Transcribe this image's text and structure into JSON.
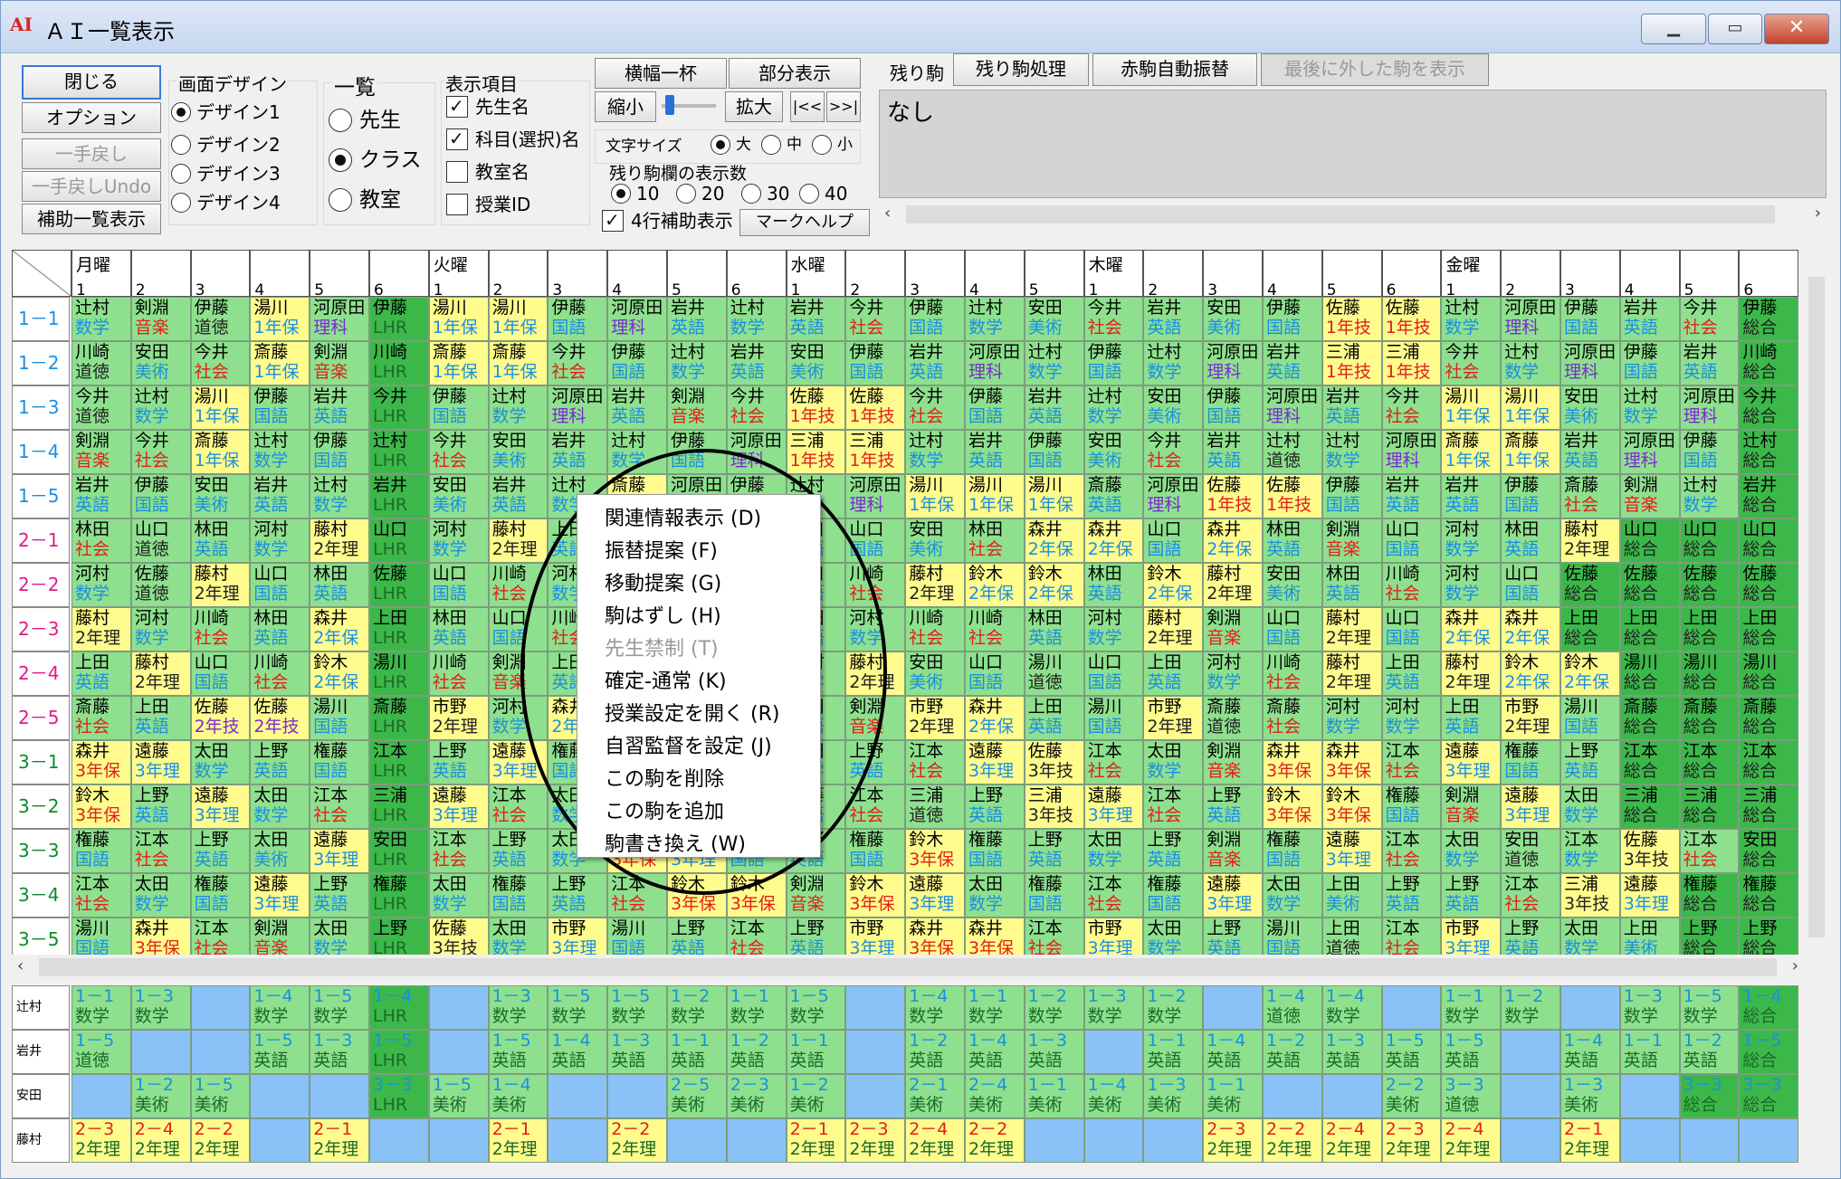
{
  "window": {
    "title": "ＡＩ一覧表示",
    "app_icon": "AI"
  },
  "toolbar": {
    "close_btn": "閉じる",
    "option_btn": "オプション",
    "undo_btn": "一手戻し",
    "undo_undo_btn": "一手戻しUndo",
    "aux_list_btn": "補助一覧表示",
    "design_label": "画面デザイン",
    "designs": [
      "デザイン1",
      "デザイン2",
      "デザイン3",
      "デザイン4"
    ],
    "list_label": "一覧",
    "list_modes": [
      "先生",
      "クラス",
      "教室"
    ],
    "display_label": "表示項目",
    "display_items": [
      "先生名",
      "科目(選択)名",
      "教室名",
      "授業ID"
    ],
    "full_width_btn": "横幅一杯",
    "partial_btn": "部分表示",
    "shrink_btn": "縮小",
    "expand_btn": "拡大",
    "prev_btn": "|<<",
    "next_btn": ">>|",
    "font_label": "文字サイズ",
    "font_sizes": [
      "大",
      "中",
      "小"
    ],
    "remain_count_label": "残り駒欄の表示数",
    "remain_counts": [
      "10",
      "20",
      "30",
      "40"
    ],
    "four_row_label": "4行補助表示",
    "mark_help_btn": "マークヘルプ",
    "remain_label": "残り駒",
    "remain_proc_btn": "残り駒処理",
    "red_auto_btn": "赤駒自動振替",
    "last_removed_btn": "最後に外した駒を表示",
    "remain_value": "なし"
  },
  "days": [
    {
      "name": "月曜",
      "periods": 6
    },
    {
      "name": "火曜",
      "periods": 6
    },
    {
      "name": "水曜",
      "periods": 5
    },
    {
      "name": "木曜",
      "periods": 6
    },
    {
      "name": "金曜",
      "periods": 6
    }
  ],
  "classes": [
    "1－1",
    "1－2",
    "1－3",
    "1－4",
    "1－5",
    "2－1",
    "2－2",
    "2－3",
    "2－4",
    "2－5",
    "3－1",
    "3－2",
    "3－3",
    "3－4",
    "3－5"
  ],
  "class_rows": [
    "辻村|数学|b|g;剣淵|音楽|r|g;伊藤|道徳|d|g;湯川|1年保|b|y;河原田|理科|p|g;伊藤|LHR|d|d;湯川|1年保|b|y;湯川|1年保|b|y;伊藤|国語|b|g;河原田|理科|p|g;岩井|英語|b|g;辻村|数学|b|g;岩井|英語|b|g;今井|社会|r|g;伊藤|国語|b|g;辻村|数学|b|g;安田|美術|b|g;今井|社会|r|g;岩井|英語|b|g;安田|美術|b|g;伊藤|国語|b|g;佐藤|1年技|r|y;佐藤|1年技|r|y;辻村|数学|b|g;河原田|理科|p|g;伊藤|国語|b|g;岩井|英語|b|g;今井|社会|r|g;伊藤|総合|d|d",
    "川崎|道徳|d|g;安田|美術|b|g;今井|社会|r|g;斎藤|1年保|b|y;剣淵|音楽|r|g;川崎|LHR|d|d;斎藤|1年保|b|y;斎藤|1年保|b|y;今井|社会|r|g;伊藤|国語|b|g;辻村|数学|b|g;岩井|英語|b|g;安田|美術|b|g;伊藤|国語|b|g;岩井|英語|b|g;河原田|理科|p|g;辻村|数学|b|g;伊藤|国語|b|g;辻村|数学|b|g;河原田|理科|p|g;岩井|英語|b|g;三浦|1年技|r|y;三浦|1年技|r|y;今井|社会|r|g;辻村|数学|b|g;河原田|理科|p|g;伊藤|国語|b|g;岩井|英語|b|g;川崎|総合|d|d",
    "今井|道徳|d|g;辻村|数学|b|g;湯川|1年保|b|y;伊藤|国語|b|g;岩井|英語|b|g;今井|LHR|d|d;伊藤|国語|b|g;辻村|数学|b|g;河原田|理科|p|g;岩井|英語|b|g;剣淵|音楽|r|g;今井|社会|r|g;佐藤|1年技|r|y;佐藤|1年技|r|y;今井|社会|r|g;伊藤|国語|b|g;岩井|英語|b|g;辻村|数学|b|g;安田|美術|b|g;伊藤|国語|b|g;河原田|理科|p|g;岩井|英語|b|g;今井|社会|r|g;湯川|1年保|b|y;湯川|1年保|b|y;安田|美術|b|g;辻村|数学|b|g;河原田|理科|p|g;今井|総合|d|d",
    "剣淵|音楽|r|g;今井|社会|r|g;斎藤|1年保|b|y;辻村|数学|b|g;伊藤|国語|b|g;辻村|LHR|d|d;今井|社会|r|g;安田|美術|b|g;岩井|英語|b|g;辻村|数学|b|g;伊藤|国語|b|g;河原田|理科|p|g;三浦|1年技|r|y;三浦|1年技|r|y;辻村|数学|b|g;岩井|英語|b|g;伊藤|国語|b|g;安田|美術|b|g;今井|社会|r|g;岩井|英語|b|g;辻村|道徳|d|g;辻村|数学|b|g;河原田|理科|p|g;斎藤|1年保|b|y;斎藤|1年保|b|y;岩井|英語|b|g;河原田|理科|p|g;伊藤|国語|b|g;辻村|総合|d|d",
    "岩井|英語|b|g;伊藤|国語|b|g;安田|美術|b|g;岩井|英語|b|g;辻村|数学|b|g;岩井|LHR|d|d;安田|美術|b|g;岩井|英語|b|g;辻村|数学|b|g;斎藤|1年保|b|y;河原田|理科|p|g;伊藤|国語|b|g;辻村|数学|b|g;河原田|理科|p|g;湯川|1年保|b|y;湯川|1年保|b|y;湯川|1年保|b|y;斎藤|英語|b|g;河原田|理科|p|g;佐藤|1年技|r|y;佐藤|1年技|r|y;伊藤|国語|b|g;岩井|英語|b|g;岩井|英語|b|g;伊藤|国語|b|g;斎藤|社会|r|g;剣淵|音楽|r|g;辻村|数学|b|g;岩井|総合|d|d",
    "林田|社会|r|g;山口|道徳|d|g;林田|英語|b|g;河村|数学|b|g;藤村|2年理|d|y;山口|LHR|d|d;河村|数学|b|g;藤村|2年理|d|y;上田|英語|b|g;山口|国語|b|g;林田|英語|b|g;森井|2年保|b|y;山口|国語|b|g;山口|国語|b|g;安田|美術|b|g;林田|社会|r|g;森井|2年保|b|y;森井|2年保|b|y;山口|国語|b|g;森井|2年保|b|y;林田|英語|b|g;剣淵|音楽|r|g;山口|国語|b|g;河村|数学|b|g;林田|英語|b|g;藤村|2年理|d|y;山口|総合|d|d;山口|総合|d|d;山口|総合|d|d",
    "河村|数学|b|g;佐藤|道徳|d|g;藤村|2年理|d|y;山口|国語|b|g;林田|英語|b|g;佐藤|LHR|d|d;山口|国語|b|g;川崎|社会|r|g;河村|数学|b|g;林田|英語|b|g;山口|国語|b|g;林田|英語|b|g;山口|国語|b|g;川崎|社会|r|g;藤村|2年理|d|y;鈴木|2年保|b|y;鈴木|2年保|b|y;林田|英語|b|g;鈴木|2年保|b|y;藤村|2年理|d|y;安田|美術|b|g;林田|英語|b|g;川崎|社会|r|g;河村|数学|b|g;山口|国語|b|g;佐藤|総合|d|d;佐藤|総合|d|d;佐藤|総合|d|d;佐藤|総合|d|d",
    "藤村|2年理|d|y;河村|数学|b|g;川崎|社会|r|g;林田|英語|b|g;森井|2年保|b|y;上田|LHR|d|d;林田|英語|b|g;山口|国語|b|g;川崎|社会|r|g;山口|国語|b|g;林田|英語|b|g;藤村|2年理|d|y;林田|英語|b|g;河村|数学|b|g;川崎|社会|r|g;川崎|社会|r|g;林田|英語|b|g;河村|数学|b|g;藤村|2年理|d|y;剣淵|音楽|r|g;山口|国語|b|g;藤村|2年理|d|y;山口|国語|b|g;森井|2年保|b|y;森井|2年保|b|y;上田|総合|d|d;上田|総合|d|d;上田|総合|d|d;上田|総合|d|d",
    "上田|英語|b|g;藤村|2年理|d|y;山口|国語|b|g;川崎|社会|r|g;鈴木|2年保|b|y;湯川|LHR|d|d;川崎|社会|r|g;剣淵|音楽|r|g;上田|英語|b|g;河村|数学|b|g;林田|英語|b|g;藤村|2年理|d|y;河村|数学|b|g;藤村|2年理|d|y;安田|美術|b|g;山口|国語|b|g;湯川|道徳|d|g;山口|国語|b|g;上田|英語|b|g;河村|数学|b|g;川崎|社会|r|g;藤村|2年理|d|y;上田|英語|b|g;藤村|2年理|d|y;鈴木|2年保|b|y;鈴木|2年保|b|y;湯川|総合|d|d;湯川|総合|d|d;湯川|総合|d|d",
    "斎藤|社会|r|g;上田|英語|b|g;佐藤|2年技|p|y;佐藤|2年技|p|y;湯川|国語|b|g;斎藤|LHR|d|d;市野|2年理|d|y;河村|数学|b|g;森井|2年保|b|y;林田|英語|b|g;山口|国語|b|g;上田|英語|b|g;上田|英語|b|g;剣淵|音楽|r|g;市野|2年理|d|y;森井|2年保|b|y;上田|英語|b|g;湯川|国語|b|g;市野|2年理|d|y;斎藤|道徳|d|g;斎藤|社会|r|g;河村|数学|b|g;河村|数学|b|g;上田|英語|b|g;市野|2年理|d|y;湯川|国語|b|g;斎藤|総合|d|d;斎藤|総合|d|d;斎藤|総合|d|d",
    "森井|3年保|r|y;遠藤|3年理|b|y;太田|数学|b|g;上野|英語|b|g;権藤|国語|b|g;江本|LHR|d|d;上野|英語|b|g;遠藤|3年理|b|y;権藤|国語|b|g;江本|社会|r|g;太田|数学|b|g;上野|英語|b|g;太田|数学|b|g;上野|英語|b|g;江本|社会|r|g;遠藤|3年理|b|y;佐藤|3年技|d|y;江本|社会|r|g;太田|数学|b|g;剣淵|音楽|r|g;森井|3年保|r|y;森井|3年保|r|y;江本|社会|r|g;遠藤|3年理|b|y;権藤|国語|b|g;上野|英語|b|g;江本|総合|d|d;江本|総合|d|d;江本|総合|d|d",
    "鈴木|3年保|r|y;上野|英語|b|g;遠藤|3年理|b|y;太田|数学|b|g;江本|社会|r|g;三浦|LHR|d|d;遠藤|3年理|b|y;江本|社会|r|g;太田|数学|b|g;上野|英語|b|g;権藤|国語|b|g;三浦|道徳|d|g;権藤|国語|b|g;江本|社会|r|g;三浦|道徳|d|g;上野|英語|b|g;三浦|3年技|d|y;遠藤|3年理|b|y;江本|社会|r|g;上野|英語|b|g;鈴木|3年保|r|y;鈴木|3年保|r|y;権藤|国語|b|g;剣淵|音楽|r|g;遠藤|3年理|b|y;太田|数学|b|g;三浦|総合|d|d;三浦|総合|d|d;三浦|総合|d|d",
    "権藤|国語|b|g;江本|社会|r|g;上野|英語|b|g;太田|美術|b|g;遠藤|3年理|b|y;安田|LHR|d|d;江本|社会|r|g;上野|英語|b|g;太田|数学|b|g;鈴木|3年保|r|y;遠藤|3年理|b|y;権藤|国語|b|g;上野|英語|b|g;権藤|国語|b|g;鈴木|3年保|r|y;権藤|国語|b|g;上野|英語|b|g;太田|数学|b|g;上野|英語|b|g;剣淵|音楽|r|g;権藤|国語|b|g;遠藤|3年理|b|y;江本|社会|r|g;太田|数学|b|g;安田|道徳|d|g;江本|数学|b|g;佐藤|3年技|d|y;江本|社会|r|g;安田|総合|d|d",
    "江本|社会|r|g;太田|数学|b|g;権藤|国語|b|g;遠藤|3年理|b|y;上野|英語|b|g;権藤|LHR|d|d;太田|数学|b|g;権藤|国語|b|g;上野|英語|b|g;江本|社会|r|g;鈴木|3年保|r|y;鈴木|3年保|r|y;剣淵|音楽|r|g;鈴木|3年保|r|y;遠藤|3年理|b|y;太田|数学|b|g;権藤|国語|b|g;江本|社会|r|g;権藤|国語|b|g;遠藤|3年理|b|y;太田|数学|b|g;上田|美術|b|g;上野|英語|b|g;上野|英語|b|g;江本|社会|r|g;三浦|3年技|d|y;遠藤|3年理|b|y;権藤|総合|d|d;権藤|総合|d|d",
    "湯川|国語|b|g;森井|3年保|r|y;江本|社会|r|g;剣淵|音楽|r|g;太田|数学|b|g;上野|LHR|d|d;佐藤|3年技|d|y;太田|数学|b|g;市野|3年理|b|y;湯川|国語|b|g;上野|英語|b|g;江本|社会|r|g;上野|英語|b|g;市野|3年理|b|y;森井|3年保|r|y;森井|3年保|r|y;江本|社会|r|g;市野|3年理|b|y;太田|数学|b|g;上野|英語|b|g;湯川|国語|b|g;上田|道徳|d|g;江本|社会|r|g;市野|3年理|b|y;上野|英語|b|g;太田|数学|b|g;上田|美術|b|g;上野|総合|d|d;上野|総合|d|d"
  ],
  "teachers": [
    "辻村",
    "岩井",
    "安田",
    "藤村"
  ],
  "teacher_rows": [
    "1－1|数学|g;1－3|数学|g;||b;1－4|数学|g;1－5|数学|g;1－4|LHR|d;||b;1－3|数学|g;1－5|数学|g;1－5|数学|g;1－2|数学|g;1－1|数学|g;1－5|数学|g;||b;1－4|数学|g;1－1|数学|g;1－2|数学|g;1－3|数学|g;1－2|数学|g;||b;1－4|道徳|g;1－4|数学|g;||b;1－1|数学|g;1－2|数学|g;||b;1－3|数学|g;1－5|数学|g;1－4|総合|d",
    "1－5|道徳|g;||b;||b;1－5|英語|g;1－3|英語|g;1－5|LHR|d;||b;1－5|英語|g;1－4|英語|g;1－3|英語|g;1－1|英語|g;1－2|英語|g;1－1|英語|g;||b;1－2|英語|g;1－4|英語|g;1－3|英語|g;||b;1－1|英語|g;1－4|英語|g;1－2|英語|g;1－3|英語|g;1－5|英語|g;1－5|英語|g;||b;1－4|英語|g;1－1|英語|g;1－2|英語|g;1－5|総合|d",
    "||b;1－2|美術|g;1－5|美術|g;||b;||b;3－3|LHR|d;1－5|美術|g;1－4|美術|g;||b;||b;2－5|美術|g;2－3|美術|g;1－2|美術|g;||b;2－1|美術|g;2－4|美術|g;1－1|美術|g;1－4|美術|g;1－3|美術|g;1－1|美術|g;||b;||b;2－2|美術|g;3－3|道徳|g;||b;1－3|美術|g;||b;3－3|総合|d;3－3|総合|d",
    "2－3|2年理|y;2－4|2年理|y;2－2|2年理|y;||b;2－1|2年理|y;||b;||b;2－1|2年理|y;||b;2－2|2年理|y;||b;||b;2－1|2年理|y;2－3|2年理|y;2－4|2年理|y;2－2|2年理|y;||b;||b;||b;2－3|2年理|y;2－2|2年理|y;2－4|2年理|y;2－3|2年理|y;2－4|2年理|y;||b;2－1|2年理|y;||b;||b;||b"
  ],
  "context_menu": [
    {
      "label": "関連情報表示 (D)",
      "enabled": true
    },
    {
      "label": "振替提案 (F)",
      "enabled": true
    },
    {
      "label": "移動提案 (G)",
      "enabled": true
    },
    {
      "label": "駒はずし (H)",
      "enabled": true
    },
    {
      "label": "先生禁制 (T)",
      "enabled": false
    },
    {
      "label": "確定-通常 (K)",
      "enabled": true
    },
    {
      "label": "授業設定を開く (R)",
      "enabled": true
    },
    {
      "label": "自習監督を設定 (J)",
      "enabled": true
    },
    {
      "label": "この駒を削除",
      "enabled": true
    },
    {
      "label": "この駒を追加",
      "enabled": true
    },
    {
      "label": "駒書き換え (W)",
      "enabled": true
    }
  ],
  "colors": {
    "green": "#8ee08e",
    "yellow": "#fffb8d",
    "dark_green": "#3cb84a",
    "blue": "#8ac2f8"
  }
}
